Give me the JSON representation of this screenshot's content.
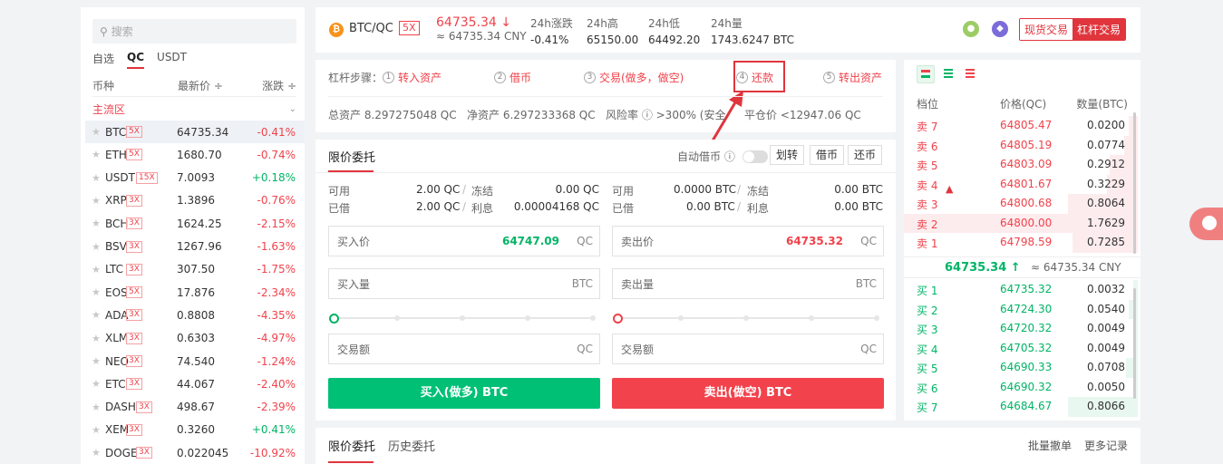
{
  "market": {
    "search_placeholder": "搜索",
    "tabs": [
      "自选",
      "QC",
      "USDT"
    ],
    "headers": {
      "coin": "币种",
      "price": "最新价 ÷",
      "change": "涨跌 ÷"
    },
    "zone": "主流区",
    "rows": [
      {
        "sym": "BTC",
        "lev": "5X",
        "price": "64735.34",
        "chg": "-0.41%",
        "up": false
      },
      {
        "sym": "ETH",
        "lev": "5X",
        "price": "1680.70",
        "chg": "-0.74%",
        "up": false
      },
      {
        "sym": "USDT",
        "lev": "15X",
        "price": "7.0093",
        "chg": "+0.18%",
        "up": true
      },
      {
        "sym": "XRP",
        "lev": "3X",
        "price": "1.3896",
        "chg": "-0.76%",
        "up": false
      },
      {
        "sym": "BCH",
        "lev": "3X",
        "price": "1624.25",
        "chg": "-2.15%",
        "up": false
      },
      {
        "sym": "BSV",
        "lev": "3X",
        "price": "1267.96",
        "chg": "-1.63%",
        "up": false
      },
      {
        "sym": "LTC",
        "lev": "3X",
        "price": "307.50",
        "chg": "-1.75%",
        "up": false
      },
      {
        "sym": "EOS",
        "lev": "5X",
        "price": "17.876",
        "chg": "-2.34%",
        "up": false
      },
      {
        "sym": "ADA",
        "lev": "3X",
        "price": "0.8808",
        "chg": "-4.35%",
        "up": false
      },
      {
        "sym": "XLM",
        "lev": "3X",
        "price": "0.6303",
        "chg": "-4.97%",
        "up": false
      },
      {
        "sym": "NEO",
        "lev": "3X",
        "price": "74.540",
        "chg": "-1.24%",
        "up": false
      },
      {
        "sym": "ETC",
        "lev": "3X",
        "price": "44.067",
        "chg": "-2.40%",
        "up": false
      },
      {
        "sym": "DASH",
        "lev": "3X",
        "price": "498.67",
        "chg": "-2.39%",
        "up": false
      },
      {
        "sym": "XEM",
        "lev": "3X",
        "price": "0.3260",
        "chg": "+0.41%",
        "up": true
      },
      {
        "sym": "DOGE",
        "lev": "3X",
        "price": "0.022045",
        "chg": "-10.92%",
        "up": false
      }
    ]
  },
  "header": {
    "logo": "₿",
    "pair": "BTC/QC",
    "leverage": "5X",
    "last_price": "64735.34 ↓",
    "last_cny": "≈ 64735.34 CNY",
    "stats": [
      {
        "label": "24h涨跌",
        "value": "-0.41%"
      },
      {
        "label": "24h高",
        "value": "65150.00"
      },
      {
        "label": "24h低",
        "value": "64492.20"
      },
      {
        "label": "24h量",
        "value": "1743.6247 BTC"
      }
    ],
    "mode_spot": "现货交易",
    "mode_margin": "杠杆交易"
  },
  "steps": {
    "title": "杠杆步骤：",
    "items": [
      {
        "n": "1",
        "label": "转入资产"
      },
      {
        "n": "2",
        "label": "借币"
      },
      {
        "n": "3",
        "label": "交易(做多，做空)"
      },
      {
        "n": "4",
        "label": "还款"
      },
      {
        "n": "5",
        "label": "转出资产"
      }
    ],
    "total_assets": "总资产 8.297275048 QC",
    "net_assets": "净资产 6.297233368 QC",
    "risk": "风险率 ⓘ  >300% (安全",
    "liquidation": "平仓价 <12947.06 QC"
  },
  "form": {
    "tab": "限价委托",
    "auto_borrow": "自动借币 ⓘ",
    "btn_transfer": "划转",
    "btn_borrow": "借币",
    "btn_repay": "还币",
    "buy_balance": {
      "avail_label": "可用",
      "avail": "2.00 QC",
      "frozen_label": "冻结",
      "frozen": "0.00 QC",
      "borrowed_label": "已借",
      "borrowed": "2.00 QC",
      "interest_label": "利息",
      "interest": "0.00004168 QC"
    },
    "sell_balance": {
      "avail_label": "可用",
      "avail": "0.0000 BTC",
      "frozen_label": "冻结",
      "frozen": "0.00 BTC",
      "borrowed_label": "已借",
      "borrowed": "0.00 BTC",
      "interest_label": "利息",
      "interest": "0.00 BTC"
    },
    "buy_price_label": "买入价",
    "buy_price": "64747.09",
    "quote_unit": "QC",
    "sell_price_label": "卖出价",
    "sell_price": "64735.32",
    "buy_amount_label": "买入量",
    "base_unit": "BTC",
    "sell_amount_label": "卖出量",
    "total_label": "交易额",
    "buy_button": "买入(做多) BTC",
    "sell_button": "卖出(做空) BTC"
  },
  "bottom": {
    "tabs": [
      "限价委托",
      "历史委托"
    ],
    "batch_cancel": "批量撤单",
    "more": "更多记录"
  },
  "book": {
    "headers": {
      "side": "档位",
      "price": "价格(QC)",
      "qty": "数量(BTC)"
    },
    "asks": [
      {
        "side": "卖 7",
        "price": "64805.47",
        "qty": "0.0200",
        "depth": 0.04
      },
      {
        "side": "卖 6",
        "price": "64805.19",
        "qty": "0.0774",
        "depth": 0.06
      },
      {
        "side": "卖 5",
        "price": "64803.09",
        "qty": "0.2912",
        "depth": 0.12
      },
      {
        "side": "卖 4",
        "price": "64801.67",
        "qty": "0.3229",
        "depth": 0.13
      },
      {
        "side": "卖 3",
        "price": "64800.68",
        "qty": "0.8064",
        "depth": 0.3
      },
      {
        "side": "卖 2",
        "price": "64800.00",
        "qty": "1.7629",
        "depth": 1.0
      },
      {
        "side": "卖 1",
        "price": "64798.59",
        "qty": "0.7285",
        "depth": 0.28
      }
    ],
    "mid_price": "64735.34 ↑",
    "mid_cny": "≈ 64735.34 CNY",
    "bids": [
      {
        "side": "买 1",
        "price": "64735.32",
        "qty": "0.0032",
        "depth": 0.02
      },
      {
        "side": "买 2",
        "price": "64724.30",
        "qty": "0.0540",
        "depth": 0.04
      },
      {
        "side": "买 3",
        "price": "64720.32",
        "qty": "0.0049",
        "depth": 0.02
      },
      {
        "side": "买 4",
        "price": "64705.32",
        "qty": "0.0049",
        "depth": 0.02
      },
      {
        "side": "买 5",
        "price": "64690.33",
        "qty": "0.0708",
        "depth": 0.05
      },
      {
        "side": "买 6",
        "price": "64690.32",
        "qty": "0.0050",
        "depth": 0.02
      },
      {
        "side": "买 7",
        "price": "64684.67",
        "qty": "0.8066",
        "depth": 0.3
      }
    ]
  },
  "colors": {
    "red": "#f0424b",
    "green": "#00b465",
    "buy_btn": "#00c076",
    "sell_btn": "#f2424c"
  }
}
